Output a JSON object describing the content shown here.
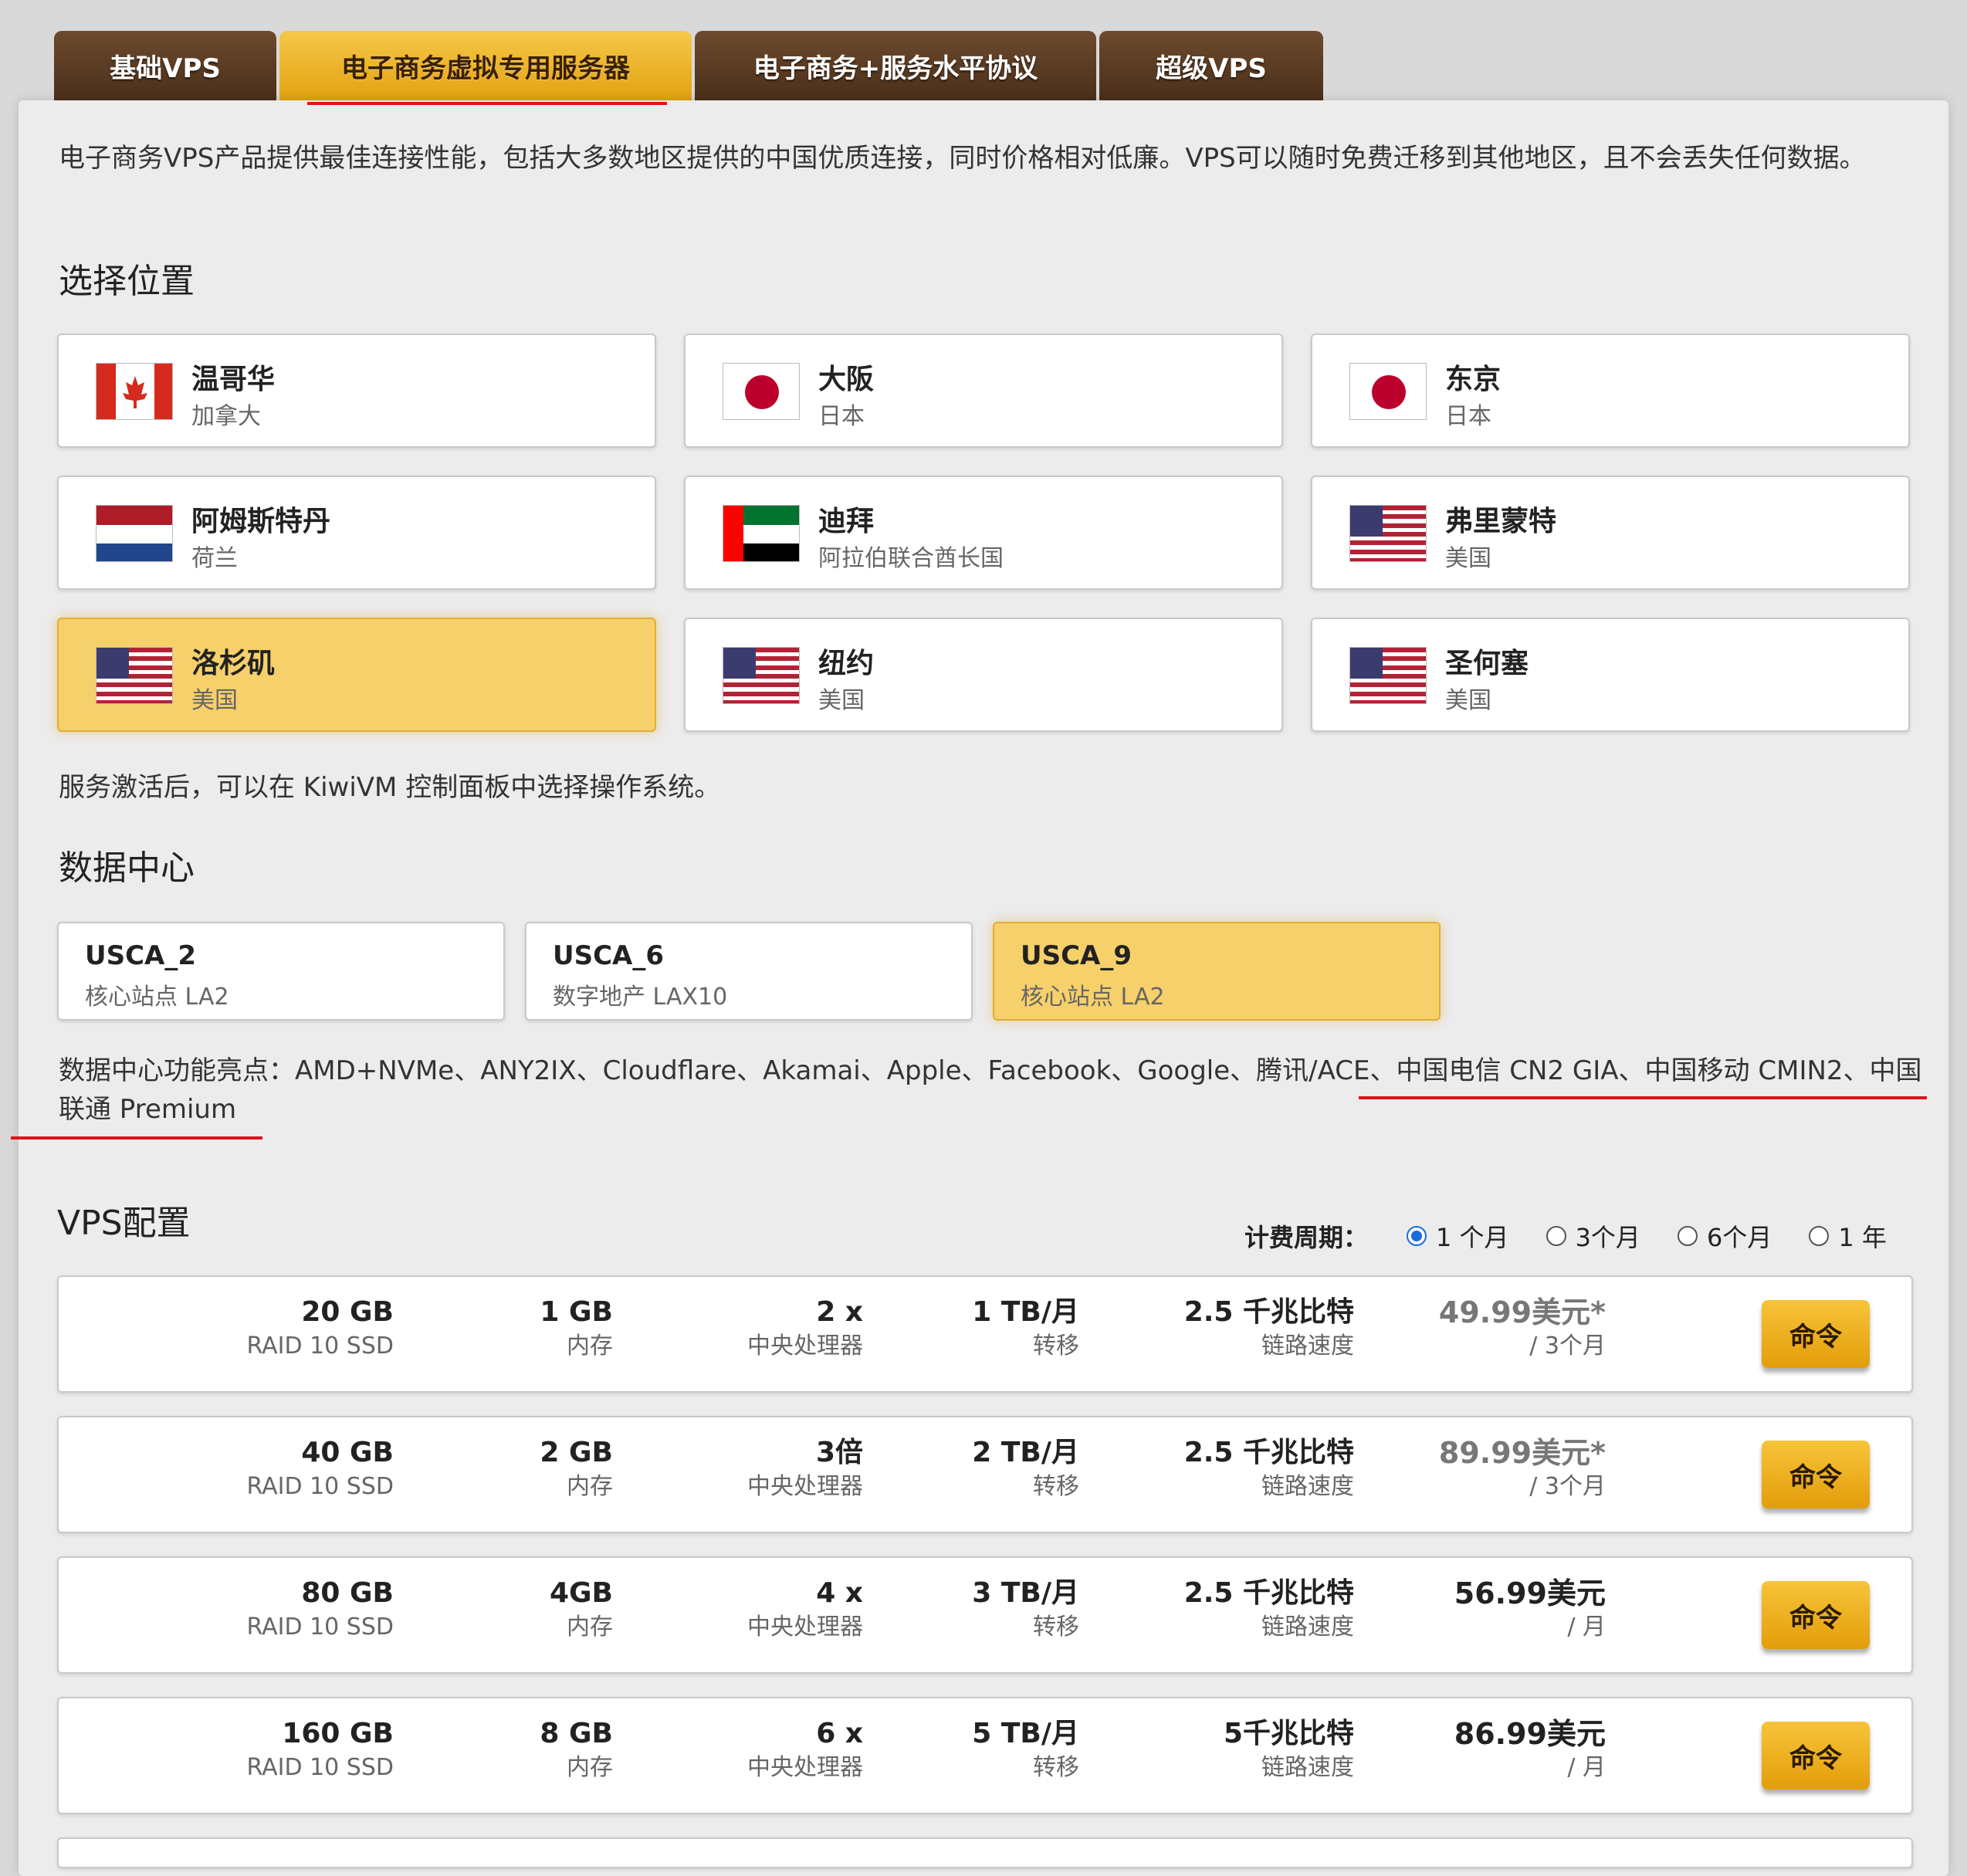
{
  "tabs": [
    {
      "label": "基础VPS",
      "active": false
    },
    {
      "label": "电子商务虚拟专用服务器",
      "active": true
    },
    {
      "label": "电子商务+服务水平协议",
      "active": false
    },
    {
      "label": "超级VPS",
      "active": false
    }
  ],
  "intro": "电子商务VPS产品提供最佳连接性能，包括大多数地区提供的中国优质连接，同时价格相对低廉。VPS可以随时免费迁移到其他地区，且不会丢失任何数据。",
  "location": {
    "title": "选择位置",
    "items": [
      {
        "city": "温哥华",
        "country": "加拿大",
        "flag": "canada-flag"
      },
      {
        "city": "大阪",
        "country": "日本",
        "flag": "japan-flag"
      },
      {
        "city": "东京",
        "country": "日本",
        "flag": "japan-flag"
      },
      {
        "city": "阿姆斯特丹",
        "country": "荷兰",
        "flag": "netherlands-flag"
      },
      {
        "city": "迪拜",
        "country": "阿拉伯联合酋长国",
        "flag": "uae-flag"
      },
      {
        "city": "弗里蒙特",
        "country": "美国",
        "flag": "usa-flag"
      },
      {
        "city": "洛杉矶",
        "country": "美国",
        "flag": "usa-flag",
        "selected": true
      },
      {
        "city": "纽约",
        "country": "美国",
        "flag": "usa-flag"
      },
      {
        "city": "圣何塞",
        "country": "美国",
        "flag": "usa-flag"
      }
    ],
    "note": "服务激活后，可以在 KiwiVM 控制面板中选择操作系统。"
  },
  "datacenter": {
    "title": "数据中心",
    "items": [
      {
        "name": "USCA_2",
        "sub": "核心站点 LA2"
      },
      {
        "name": "USCA_6",
        "sub": "数字地产 LAX10"
      },
      {
        "name": "USCA_9",
        "sub": "核心站点 LA2",
        "selected": true
      }
    ],
    "highlights": "数据中心功能亮点：AMD+NVMe、ANY2IX、Cloudflare、Akamai、Apple、Facebook、Google、腾讯/ACE、中国电信 CN2 GIA、中国移动 CMIN2、中国联通 Premium"
  },
  "vps": {
    "title": "VPS配置",
    "billing_label": "计费周期：",
    "billing_options": [
      "1 个月",
      "3个月",
      "6个月",
      "1 年"
    ],
    "billing_selected": 0,
    "order_label": "命令",
    "plans": [
      {
        "disk": "20 GB",
        "disk_type": "RAID 10 SSD",
        "ram": "1 GB",
        "ram_label": "内存",
        "cpu": "2 x",
        "cpu_label": "中央处理器",
        "transfer": "1 TB/月",
        "transfer_label": "转移",
        "link": "2.5 千兆比特",
        "link_label": "链路速度",
        "price": "49.99美元*",
        "period": "/ 3个月",
        "promo": true
      },
      {
        "disk": "40 GB",
        "disk_type": "RAID 10 SSD",
        "ram": "2 GB",
        "ram_label": "内存",
        "cpu": "3倍",
        "cpu_label": "中央处理器",
        "transfer": "2 TB/月",
        "transfer_label": "转移",
        "link": "2.5 千兆比特",
        "link_label": "链路速度",
        "price": "89.99美元*",
        "period": "/ 3个月",
        "promo": true
      },
      {
        "disk": "80 GB",
        "disk_type": "RAID 10 SSD",
        "ram": "4GB",
        "ram_label": "内存",
        "cpu": "4 x",
        "cpu_label": "中央处理器",
        "transfer": "3 TB/月",
        "transfer_label": "转移",
        "link": "2.5 千兆比特",
        "link_label": "链路速度",
        "price": "56.99美元",
        "period": "/ 月",
        "promo": false
      },
      {
        "disk": "160 GB",
        "disk_type": "RAID 10 SSD",
        "ram": "8 GB",
        "ram_label": "内存",
        "cpu": "6 x",
        "cpu_label": "中央处理器",
        "transfer": "5 TB/月",
        "transfer_label": "转移",
        "link": "5千兆比特",
        "link_label": "链路速度",
        "price": "86.99美元",
        "period": "/ 月",
        "promo": false
      }
    ]
  }
}
